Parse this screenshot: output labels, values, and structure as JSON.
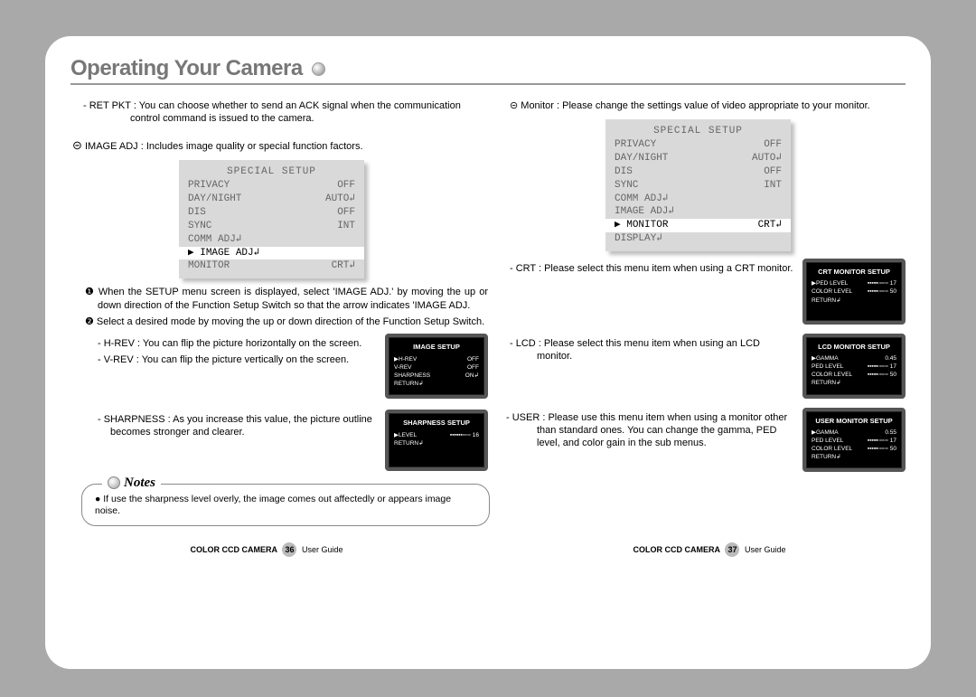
{
  "header": {
    "title": "Operating Your Camera"
  },
  "left": {
    "ret_pkt": "- RET PKT : You can choose whether to send an ACK signal when the communication control command is issued to the camera.",
    "image_adj_lead": " IMAGE ADJ : Includes image quality or special function factors.",
    "menu": {
      "title": "SPECIAL SETUP",
      "rows": [
        [
          "PRIVACY",
          "OFF"
        ],
        [
          "DAY/NIGHT",
          "AUTO↲"
        ],
        [
          "DIS",
          "OFF"
        ],
        [
          "SYNC",
          "INT"
        ],
        [
          "COMM ADJ↲",
          ""
        ],
        [
          "▶ IMAGE ADJ↲",
          ""
        ],
        [
          "MONITOR",
          "CRT↲"
        ]
      ],
      "highlight_index": 5
    },
    "step1": "❶ When the SETUP menu screen is displayed, select 'IMAGE ADJ.' by moving the up or down direction of the Function Setup Switch so that the arrow indicates 'IMAGE ADJ.",
    "step2": "❷ Select a desired mode by moving the up or down direction of the Function Setup Switch.",
    "hrev": "- H-REV : You can flip the picture horizontally on the screen.",
    "vrev": "- V-REV : You can flip the picture vertically on the screen.",
    "image_setup_box": {
      "title": "IMAGE SETUP",
      "rows": [
        [
          "▶H-REV",
          "OFF"
        ],
        [
          "V-REV",
          "OFF"
        ],
        [
          "SHARPNESS",
          "ON↲"
        ],
        [
          "RETURN↲",
          ""
        ]
      ]
    },
    "sharp_txt": "- SHARPNESS : As you increase this value, the picture outline becomes stronger and clearer.",
    "sharp_box": {
      "title": "SHARPNESS SETUP",
      "rows": [
        [
          "▶LEVEL",
          "▪▪▪▪▪▪▫▫▫▫ 16"
        ],
        [
          "RETURN↲",
          ""
        ]
      ]
    },
    "note": "● If use the sharpness level overly, the image comes out affectedly or appears image noise."
  },
  "right": {
    "monitor_lead": " Monitor : Please change the settings value of video appropriate to your monitor.",
    "menu": {
      "title": "SPECIAL SETUP",
      "rows": [
        [
          "PRIVACY",
          "OFF"
        ],
        [
          "DAY/NIGHT",
          "AUTO↲"
        ],
        [
          "DIS",
          "OFF"
        ],
        [
          "SYNC",
          "INT"
        ],
        [
          "COMM ADJ↲",
          ""
        ],
        [
          "IMAGE ADJ↲",
          ""
        ],
        [
          "▶ MONITOR",
          "CRT↲"
        ],
        [
          "DISPLAY↲",
          ""
        ]
      ],
      "highlight_index": 6
    },
    "crt_txt": "- CRT : Please select this menu item when using a CRT monitor.",
    "crt_box": {
      "title": "CRT MONITOR SETUP",
      "rows": [
        [
          "▶PED LEVEL",
          "▪▪▪▪▪▫▫▫▫▫ 17"
        ],
        [
          "COLOR LEVEL",
          "▪▪▪▪▪▫▫▫▫▫ 50"
        ],
        [
          "RETURN↲",
          ""
        ]
      ]
    },
    "lcd_txt": "- LCD : Please select this menu item when using an LCD monitor.",
    "lcd_box": {
      "title": "LCD MONITOR SETUP",
      "rows": [
        [
          "▶GAMMA",
          "0.45"
        ],
        [
          "PED LEVEL",
          "▪▪▪▪▪▫▫▫▫▫ 17"
        ],
        [
          "COLOR LEVEL",
          "▪▪▪▪▪▫▫▫▫▫ 50"
        ],
        [
          "RETURN↲",
          ""
        ]
      ]
    },
    "user_txt": "- USER : Please use this menu item when using a monitor other than standard ones. You can change the gamma, PED level, and color gain in the sub menus.",
    "user_box": {
      "title": "USER MONITOR SETUP",
      "rows": [
        [
          "▶GAMMA",
          "0.55"
        ],
        [
          "PED LEVEL",
          "▪▪▪▪▪▫▫▫▫▫ 17"
        ],
        [
          "COLOR LEVEL",
          "▪▪▪▪▪▫▫▫▫▫ 50"
        ],
        [
          "RETURN↲",
          ""
        ]
      ]
    }
  },
  "footer": {
    "product": "COLOR CCD CAMERA",
    "guide": "User Guide",
    "page_left": "36",
    "page_right": "37"
  },
  "notes_label": "Notes"
}
